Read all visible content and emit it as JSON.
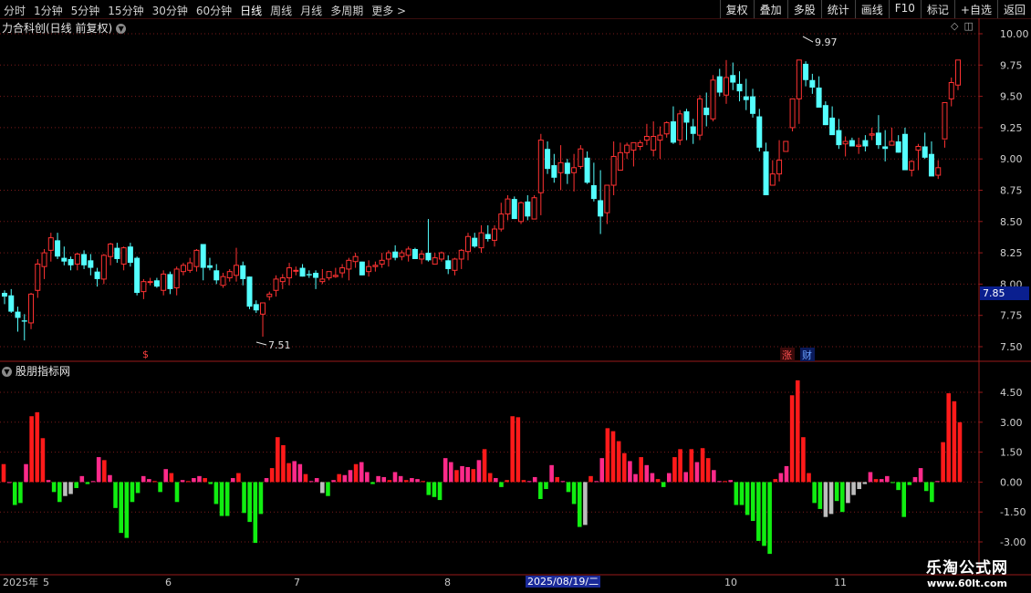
{
  "toolbar": {
    "periods": [
      "分时",
      "1分钟",
      "5分钟",
      "15分钟",
      "30分钟",
      "60分钟",
      "日线",
      "周线",
      "月线",
      "多周期",
      "更多 >"
    ],
    "active": "日线",
    "actions": [
      "复权",
      "叠加",
      "多股",
      "统计",
      "画线",
      "F10",
      "标记",
      "+自选",
      "返回"
    ]
  },
  "main_title": "力合科创(日线 前复权)",
  "sub_title": "股朋指标网",
  "current_price": "7.85",
  "high_annotation": "9.97",
  "low_annotation": "7.51",
  "markers": {
    "dollar": "$",
    "zhang": "涨",
    "cai": "财"
  },
  "date_labels": {
    "year": "2025年",
    "m5": "5",
    "m6": "6",
    "m7": "7",
    "m8": "8",
    "m10": "10",
    "m11": "11"
  },
  "highlight_date": "2025/08/19/二",
  "watermark": {
    "line1": "乐淘公式网",
    "line2": "www.60lt.com"
  },
  "colors": {
    "up": "#ff3232",
    "down": "#54ffff",
    "bar_red": "#ff1a1a",
    "bar_pink": "#ff2a8a",
    "bar_green": "#11ee11",
    "bar_gray": "#bdbdbd",
    "grid": "#7a1a1a"
  },
  "chart_data": [
    {
      "type": "candlestick",
      "y_ticks": [
        "10.00",
        "9.75",
        "9.50",
        "9.25",
        "9.00",
        "8.75",
        "8.50",
        "8.25",
        "8.00",
        "7.75",
        "7.50"
      ],
      "ylim": [
        7.42,
        10.05
      ],
      "candles": [
        [
          7.93,
          7.95,
          7.84,
          7.9
        ],
        [
          7.91,
          7.96,
          7.77,
          7.78
        ],
        [
          7.78,
          7.82,
          7.62,
          7.73
        ],
        [
          7.71,
          7.76,
          7.55,
          7.7
        ],
        [
          7.69,
          7.93,
          7.64,
          7.92
        ],
        [
          7.95,
          8.2,
          7.89,
          8.16
        ],
        [
          8.14,
          8.28,
          8.04,
          8.25
        ],
        [
          8.27,
          8.41,
          8.18,
          8.37
        ],
        [
          8.35,
          8.41,
          8.2,
          8.22
        ],
        [
          8.21,
          8.3,
          8.15,
          8.18
        ],
        [
          8.2,
          8.22,
          8.11,
          8.15
        ],
        [
          8.16,
          8.25,
          8.11,
          8.24
        ],
        [
          8.24,
          8.27,
          8.12,
          8.15
        ],
        [
          8.19,
          8.24,
          8.07,
          8.13
        ],
        [
          8.1,
          8.13,
          7.98,
          8.04
        ],
        [
          8.04,
          8.24,
          8.0,
          8.23
        ],
        [
          8.22,
          8.33,
          8.15,
          8.32
        ],
        [
          8.29,
          8.33,
          8.17,
          8.2
        ],
        [
          8.16,
          8.3,
          8.11,
          8.29
        ],
        [
          8.3,
          8.33,
          8.14,
          8.17
        ],
        [
          8.21,
          8.22,
          7.91,
          7.93
        ],
        [
          7.94,
          8.04,
          7.88,
          8.02
        ],
        [
          8.02,
          8.05,
          7.99,
          8.02
        ],
        [
          8.03,
          8.05,
          7.97,
          7.98
        ],
        [
          7.95,
          8.11,
          7.91,
          8.08
        ],
        [
          8.08,
          8.1,
          7.92,
          7.96
        ],
        [
          7.97,
          8.14,
          7.91,
          8.12
        ],
        [
          8.1,
          8.17,
          8.07,
          8.15
        ],
        [
          8.11,
          8.21,
          8.09,
          8.17
        ],
        [
          8.14,
          8.28,
          8.1,
          8.27
        ],
        [
          8.32,
          8.32,
          8.03,
          8.13
        ],
        [
          8.15,
          8.21,
          8.11,
          8.13
        ],
        [
          8.11,
          8.16,
          8.0,
          8.03
        ],
        [
          7.99,
          8.09,
          7.97,
          8.06
        ],
        [
          8.05,
          8.12,
          8.02,
          8.1
        ],
        [
          8.07,
          8.29,
          8.02,
          8.15
        ],
        [
          8.15,
          8.18,
          7.99,
          8.04
        ],
        [
          8.06,
          8.06,
          7.8,
          7.82
        ],
        [
          7.84,
          7.87,
          7.77,
          7.79
        ],
        [
          7.76,
          7.85,
          7.58,
          7.85
        ],
        [
          7.9,
          7.94,
          7.87,
          7.92
        ],
        [
          7.95,
          8.07,
          7.9,
          8.04
        ],
        [
          8.02,
          8.08,
          7.96,
          8.05
        ],
        [
          8.05,
          8.17,
          7.99,
          8.13
        ],
        [
          8.11,
          8.14,
          8.07,
          8.11
        ],
        [
          8.13,
          8.16,
          8.06,
          8.06
        ],
        [
          8.08,
          8.11,
          8.05,
          8.07
        ],
        [
          8.09,
          8.11,
          7.96,
          8.05
        ],
        [
          8.02,
          8.12,
          8.0,
          8.04
        ],
        [
          8.05,
          8.1,
          8.03,
          8.1
        ],
        [
          8.06,
          8.13,
          8.05,
          8.07
        ],
        [
          8.09,
          8.16,
          8.05,
          8.13
        ],
        [
          8.12,
          8.21,
          8.03,
          8.19
        ],
        [
          8.18,
          8.25,
          8.13,
          8.22
        ],
        [
          8.18,
          8.18,
          8.07,
          8.07
        ],
        [
          8.1,
          8.19,
          8.06,
          8.14
        ],
        [
          8.14,
          8.18,
          8.1,
          8.15
        ],
        [
          8.16,
          8.25,
          8.13,
          8.19
        ],
        [
          8.2,
          8.27,
          8.14,
          8.25
        ],
        [
          8.26,
          8.31,
          8.19,
          8.21
        ],
        [
          8.22,
          8.27,
          8.19,
          8.25
        ],
        [
          8.23,
          8.3,
          8.18,
          8.28
        ],
        [
          8.28,
          8.29,
          8.2,
          8.2
        ],
        [
          8.2,
          8.27,
          8.16,
          8.24
        ],
        [
          8.25,
          8.52,
          8.18,
          8.19
        ],
        [
          8.16,
          8.25,
          8.16,
          8.21
        ],
        [
          8.2,
          8.26,
          8.18,
          8.25
        ],
        [
          8.19,
          8.23,
          8.08,
          8.12
        ],
        [
          8.11,
          8.21,
          8.07,
          8.2
        ],
        [
          8.2,
          8.28,
          8.12,
          8.27
        ],
        [
          8.26,
          8.41,
          8.19,
          8.38
        ],
        [
          8.37,
          8.41,
          8.29,
          8.3
        ],
        [
          8.29,
          8.47,
          8.25,
          8.41
        ],
        [
          8.4,
          8.47,
          8.34,
          8.36
        ],
        [
          8.35,
          8.47,
          8.3,
          8.44
        ],
        [
          8.44,
          8.65,
          8.42,
          8.56
        ],
        [
          8.56,
          8.71,
          8.51,
          8.68
        ],
        [
          8.68,
          8.7,
          8.52,
          8.52
        ],
        [
          8.5,
          8.66,
          8.48,
          8.65
        ],
        [
          8.66,
          8.71,
          8.51,
          8.54
        ],
        [
          8.52,
          8.71,
          8.52,
          8.69
        ],
        [
          8.73,
          9.2,
          8.55,
          9.15
        ],
        [
          9.08,
          9.14,
          8.88,
          8.92
        ],
        [
          8.95,
          9.04,
          8.81,
          8.85
        ],
        [
          8.89,
          9.11,
          8.75,
          8.97
        ],
        [
          8.97,
          9.0,
          8.8,
          8.88
        ],
        [
          8.89,
          9.04,
          8.74,
          8.93
        ],
        [
          8.94,
          9.11,
          8.92,
          9.08
        ],
        [
          9.01,
          9.06,
          8.8,
          8.81
        ],
        [
          8.79,
          8.97,
          8.66,
          8.68
        ],
        [
          8.67,
          8.91,
          8.4,
          8.54
        ],
        [
          8.57,
          8.79,
          8.48,
          8.79
        ],
        [
          8.79,
          9.14,
          8.71,
          9.02
        ],
        [
          8.91,
          9.13,
          8.93,
          9.05
        ],
        [
          9.05,
          9.13,
          9.0,
          9.11
        ],
        [
          9.07,
          9.13,
          8.94,
          9.13
        ],
        [
          9.1,
          9.15,
          9.07,
          9.13
        ],
        [
          9.15,
          9.28,
          9.11,
          9.18
        ],
        [
          9.07,
          9.3,
          9.02,
          9.18
        ],
        [
          9.15,
          9.26,
          9.0,
          9.19
        ],
        [
          9.2,
          9.3,
          9.17,
          9.29
        ],
        [
          9.3,
          9.42,
          9.12,
          9.13
        ],
        [
          9.15,
          9.39,
          9.11,
          9.36
        ],
        [
          9.38,
          9.4,
          9.15,
          9.29
        ],
        [
          9.26,
          9.32,
          9.12,
          9.2
        ],
        [
          9.19,
          9.51,
          9.15,
          9.48
        ],
        [
          9.41,
          9.53,
          9.26,
          9.35
        ],
        [
          9.32,
          9.67,
          9.3,
          9.63
        ],
        [
          9.66,
          9.72,
          9.5,
          9.53
        ],
        [
          9.51,
          9.79,
          9.44,
          9.65
        ],
        [
          9.67,
          9.77,
          9.55,
          9.61
        ],
        [
          9.6,
          9.7,
          9.46,
          9.54
        ],
        [
          9.5,
          9.64,
          9.39,
          9.47
        ],
        [
          9.5,
          9.56,
          9.33,
          9.36
        ],
        [
          9.34,
          9.4,
          9.06,
          9.09
        ],
        [
          9.06,
          9.13,
          8.71,
          8.71
        ],
        [
          8.79,
          8.99,
          8.79,
          8.88
        ],
        [
          8.88,
          9.15,
          8.82,
          8.99
        ],
        [
          9.06,
          9.13,
          9.08,
          9.14
        ],
        [
          9.25,
          9.46,
          9.22,
          9.48
        ],
        [
          9.48,
          9.54,
          9.28,
          9.79
        ],
        [
          9.76,
          9.78,
          9.58,
          9.63
        ],
        [
          9.63,
          9.68,
          9.52,
          9.57
        ],
        [
          9.57,
          9.66,
          9.42,
          9.41
        ],
        [
          9.43,
          9.46,
          9.27,
          9.27
        ],
        [
          9.33,
          9.42,
          9.22,
          9.19
        ],
        [
          9.23,
          9.32,
          9.08,
          9.11
        ],
        [
          9.12,
          9.18,
          9.02,
          9.14
        ],
        [
          9.15,
          9.17,
          9.1,
          9.1
        ],
        [
          9.1,
          9.17,
          9.04,
          9.11
        ],
        [
          9.15,
          9.19,
          9.06,
          9.1
        ],
        [
          9.19,
          9.25,
          9.15,
          9.2
        ],
        [
          9.21,
          9.35,
          9.08,
          9.11
        ],
        [
          9.1,
          9.23,
          8.98,
          9.08
        ],
        [
          9.11,
          9.25,
          9.12,
          9.14
        ],
        [
          9.14,
          9.19,
          9.05,
          9.05
        ],
        [
          9.2,
          9.25,
          8.96,
          8.91
        ],
        [
          8.91,
          8.99,
          8.86,
          8.98
        ],
        [
          9.07,
          9.12,
          8.91,
          9.1
        ],
        [
          9.1,
          9.21,
          9.0,
          9.01
        ],
        [
          9.04,
          9.14,
          8.87,
          8.86
        ],
        [
          8.87,
          8.99,
          8.84,
          8.93
        ],
        [
          9.16,
          9.15,
          9.09,
          9.45
        ],
        [
          9.48,
          9.65,
          9.42,
          9.61
        ],
        [
          9.59,
          9.68,
          9.55,
          9.79
        ]
      ],
      "annotations": [
        {
          "text": "9.97",
          "at": "high"
        },
        {
          "text": "7.51",
          "at": "low"
        }
      ]
    },
    {
      "type": "bar",
      "title": "股朋指标网",
      "y_ticks": [
        "4.50",
        "3.00",
        "1.50",
        "0.00",
        "-1.50",
        "-3.00"
      ],
      "ylim": [
        -3.6,
        5.4
      ],
      "values": [
        0.9,
        0,
        -1.15,
        -1.05,
        0.9,
        3.3,
        3.5,
        2.2,
        0.1,
        -0.5,
        -1.0,
        -0.7,
        -0.6,
        -0.3,
        0.3,
        -0.1,
        0.05,
        1.25,
        1.1,
        0.35,
        -1.3,
        -2.55,
        -2.8,
        -1.0,
        -0.55,
        0.3,
        0.15,
        0.05,
        -0.5,
        0.65,
        0.45,
        -1.0,
        0.1,
        0.05,
        0.2,
        0.3,
        0.2,
        -0.1,
        -1.1,
        -1.7,
        -1.7,
        0.2,
        0.45,
        -1.55,
        -2.0,
        -3.05,
        -1.6,
        0.2,
        0.7,
        2.25,
        1.85,
        0.95,
        1.05,
        0.9,
        0.4,
        0.05,
        0.2,
        -0.55,
        -0.7,
        0.1,
        0.4,
        0.35,
        0.6,
        0.9,
        1.0,
        0.5,
        -0.1,
        0.3,
        0.25,
        0.1,
        0.5,
        0.3,
        0.1,
        0.2,
        0.15,
        0.05,
        -0.65,
        -0.75,
        -0.9,
        1.2,
        1.0,
        0.6,
        0.8,
        0.75,
        0.65,
        1.1,
        1.65,
        0.45,
        0.2,
        -0.25,
        0.1,
        3.3,
        3.25,
        0.1,
        0.05,
        0.25,
        -0.85,
        -0.35,
        0.85,
        0.25,
        0.05,
        -0.5,
        -1.1,
        -2.25,
        -2.15,
        0.3,
        0.05,
        1.2,
        2.7,
        2.55,
        2.05,
        1.45,
        1.05,
        0.4,
        1.25,
        0.85,
        0.45,
        0.15,
        -0.25,
        0.45,
        1.25,
        1.65,
        0.5,
        1.65,
        1.0,
        1.7,
        1.2,
        0.6,
        0.05,
        0.05,
        0.1,
        -1.15,
        -1.15,
        -1.65,
        -1.95,
        -2.95,
        -3.2,
        -3.6,
        0.15,
        0.45,
        0.8,
        4.35,
        5.1,
        2.25,
        0.45,
        -1.05,
        -1.35,
        -1.75,
        -1.6,
        -0.95,
        -1.5,
        -1.05,
        -0.65,
        -0.35,
        -0.1,
        0.5,
        0.15,
        0.15,
        0.3,
        -0.05,
        -0.4,
        -1.75,
        -0.15,
        0.25,
        0.7,
        -0.45,
        -1.0,
        0.05,
        2.0,
        4.45,
        4.05,
        3.0
      ],
      "gray_indices": [
        11,
        12,
        26,
        27,
        41,
        47,
        56,
        57,
        59,
        65,
        68,
        104,
        138,
        147,
        148,
        151,
        152,
        153,
        154,
        156
      ]
    }
  ]
}
